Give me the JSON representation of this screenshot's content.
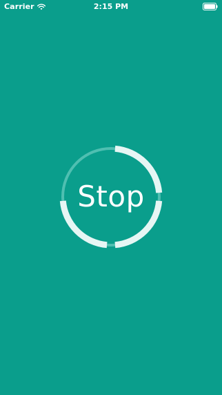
{
  "status_bar": {
    "carrier": "Carrier",
    "time": "2:15 PM",
    "wifi_icon": "wifi-icon",
    "battery_icon": "battery-full-icon"
  },
  "main": {
    "stop_label": "Stop",
    "timer_segments_active": 3,
    "timer_segments_total": 4
  },
  "colors": {
    "background": "#0a9e8c",
    "ring_track": "#4fbfb1",
    "ring_segment": "#e6f6f4",
    "text": "#ffffff"
  }
}
